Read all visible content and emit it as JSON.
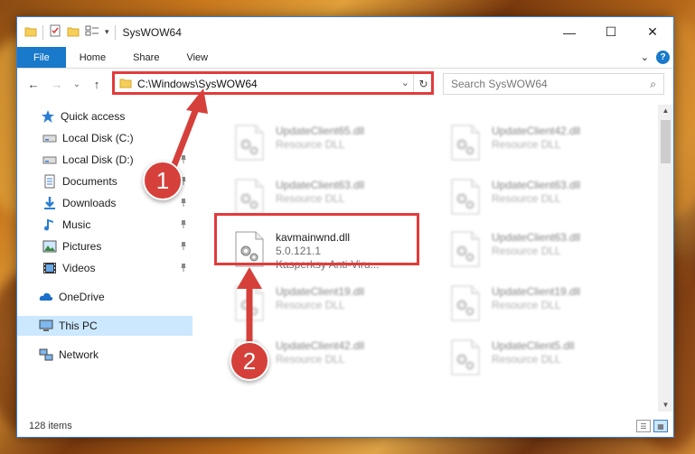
{
  "window": {
    "title": "SysWOW64",
    "controls": {
      "minimize": "—",
      "maximize": "☐",
      "close": "✕"
    }
  },
  "ribbon": {
    "tabs": [
      "File",
      "Home",
      "Share",
      "View"
    ],
    "expand_glyph": "⌄",
    "help_glyph": "?"
  },
  "nav": {
    "back_glyph": "←",
    "forward_glyph": "→",
    "recent_glyph": "⌄",
    "up_glyph": "↑",
    "address": "C:\\Windows\\SysWOW64",
    "address_dropdown_glyph": "⌄",
    "refresh_glyph": "↻",
    "search_placeholder": "Search SysWOW64",
    "search_glyph": "⌕"
  },
  "sidebar": {
    "items": [
      {
        "label": "Quick access",
        "icon": "star-icon",
        "pinned": false
      },
      {
        "label": "Local Disk (C:)",
        "icon": "drive-icon",
        "pinned": false
      },
      {
        "label": "Local Disk (D:)",
        "icon": "drive-icon",
        "pinned": true
      },
      {
        "label": "Documents",
        "icon": "documents-icon",
        "pinned": true
      },
      {
        "label": "Downloads",
        "icon": "download-icon",
        "pinned": true
      },
      {
        "label": "Music",
        "icon": "music-icon",
        "pinned": true
      },
      {
        "label": "Pictures",
        "icon": "pictures-icon",
        "pinned": true
      },
      {
        "label": "Videos",
        "icon": "videos-icon",
        "pinned": true
      },
      {
        "label": "OneDrive",
        "icon": "cloud-icon",
        "pinned": false
      },
      {
        "label": "This PC",
        "icon": "computer-icon",
        "pinned": false,
        "selected": true
      },
      {
        "label": "Network",
        "icon": "network-icon",
        "pinned": false
      }
    ],
    "pin_glyph": "📌"
  },
  "files": {
    "col1": [
      {
        "name": "UpdateClient65.dll",
        "desc": "Resource DLL"
      },
      {
        "name": "UpdateClient63.dll",
        "desc": "Resource DLL"
      },
      {
        "name": "kavmainwnd.dll",
        "desc": "5.0.121.1",
        "desc2": "Kasperksy Anti-Viru...",
        "highlighted": true
      },
      {
        "name": "UpdateClient19.dll",
        "desc": "Resource DLL"
      },
      {
        "name": "UpdateClient42.dll",
        "desc": "Resource DLL"
      }
    ],
    "col2": [
      {
        "name": "UpdateClient42.dll",
        "desc": "Resource DLL"
      },
      {
        "name": "UpdateClient63.dll",
        "desc": "Resource DLL"
      },
      {
        "name": "UpdateClient63.dll",
        "desc": "Resource DLL"
      },
      {
        "name": "UpdateClient19.dll",
        "desc": "Resource DLL"
      },
      {
        "name": "UpdateClient5.dll",
        "desc": "Resource DLL"
      }
    ]
  },
  "scrollbar": {
    "up_glyph": "▲",
    "down_glyph": "▼"
  },
  "status": {
    "item_count": "128 items",
    "details_glyph": "☰",
    "tiles_glyph": "▦"
  },
  "callouts": {
    "one": "1",
    "two": "2"
  },
  "colors": {
    "accent": "#1979ca",
    "highlight": "#e23b3b",
    "badge": "#d6403a"
  }
}
